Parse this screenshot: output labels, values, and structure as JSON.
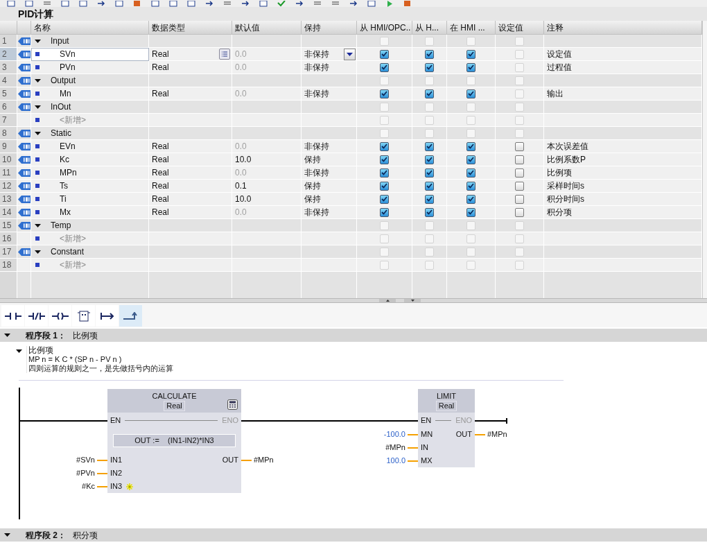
{
  "block_title": "PID计算",
  "columns": [
    "名称",
    "数据类型",
    "默认值",
    "保持",
    "从 HMI/OPC..",
    "从 H...",
    "在 HMI ...",
    "设定值",
    "注释"
  ],
  "rows": [
    {
      "number": "1",
      "kind": "section",
      "name": "Input",
      "expanded": true,
      "selected": false,
      "checks": [
        {
          "checked": false,
          "disabled": true
        },
        {
          "checked": false,
          "disabled": true
        },
        {
          "checked": false,
          "disabled": true
        },
        {
          "checked": false,
          "disabled": true
        }
      ]
    },
    {
      "number": "2",
      "kind": "variable",
      "name": "SVn",
      "type": "Real",
      "default": "0.0",
      "dimmed": true,
      "retain": "非保持",
      "comment": "设定值",
      "selected": true,
      "checks": [
        {
          "checked": true,
          "disabled": false
        },
        {
          "checked": true,
          "disabled": false
        },
        {
          "checked": true,
          "disabled": false
        },
        {
          "checked": false,
          "disabled": true
        }
      ]
    },
    {
      "number": "3",
      "kind": "variable",
      "name": "PVn",
      "type": "Real",
      "default": "0.0",
      "dimmed": true,
      "retain": "非保持",
      "comment": "过程值",
      "selected": false,
      "checks": [
        {
          "checked": true,
          "disabled": false
        },
        {
          "checked": true,
          "disabled": false
        },
        {
          "checked": true,
          "disabled": false
        },
        {
          "checked": false,
          "disabled": true
        }
      ]
    },
    {
      "number": "4",
      "kind": "section",
      "name": "Output",
      "expanded": true,
      "selected": false,
      "checks": [
        {
          "checked": false,
          "disabled": true
        },
        {
          "checked": false,
          "disabled": true
        },
        {
          "checked": false,
          "disabled": true
        },
        {
          "checked": false,
          "disabled": true
        }
      ]
    },
    {
      "number": "5",
      "kind": "variable",
      "name": "Mn",
      "type": "Real",
      "default": "0.0",
      "dimmed": true,
      "retain": "非保持",
      "comment": "输出",
      "selected": false,
      "checks": [
        {
          "checked": true,
          "disabled": false
        },
        {
          "checked": true,
          "disabled": false
        },
        {
          "checked": true,
          "disabled": false
        },
        {
          "checked": false,
          "disabled": true
        }
      ]
    },
    {
      "number": "6",
      "kind": "section",
      "name": "InOut",
      "expanded": true,
      "selected": false,
      "checks": [
        {
          "checked": false,
          "disabled": true
        },
        {
          "checked": false,
          "disabled": true
        },
        {
          "checked": false,
          "disabled": true
        },
        {
          "checked": false,
          "disabled": true
        }
      ]
    },
    {
      "number": "7",
      "kind": "new",
      "name": "<新增>",
      "selected": false,
      "checks": [
        {
          "checked": false,
          "disabled": true
        },
        {
          "checked": false,
          "disabled": true
        },
        {
          "checked": false,
          "disabled": true
        },
        {
          "checked": false,
          "disabled": true
        }
      ]
    },
    {
      "number": "8",
      "kind": "section",
      "name": "Static",
      "expanded": true,
      "selected": false,
      "checks": [
        {
          "checked": false,
          "disabled": true
        },
        {
          "checked": false,
          "disabled": true
        },
        {
          "checked": false,
          "disabled": true
        },
        {
          "checked": false,
          "disabled": true
        }
      ]
    },
    {
      "number": "9",
      "kind": "variable",
      "name": "EVn",
      "type": "Real",
      "default": "0.0",
      "dimmed": true,
      "retain": "非保持",
      "comment": "本次误差值",
      "selected": false,
      "checks": [
        {
          "checked": true,
          "disabled": false
        },
        {
          "checked": true,
          "disabled": false
        },
        {
          "checked": true,
          "disabled": false
        },
        {
          "checked": false,
          "disabled": false
        }
      ]
    },
    {
      "number": "10",
      "kind": "variable",
      "name": "Kc",
      "type": "Real",
      "default": "10.0",
      "dimmed": false,
      "retain": "保持",
      "comment": "比例系数P",
      "selected": false,
      "checks": [
        {
          "checked": true,
          "disabled": false
        },
        {
          "checked": true,
          "disabled": false
        },
        {
          "checked": true,
          "disabled": false
        },
        {
          "checked": false,
          "disabled": false
        }
      ]
    },
    {
      "number": "11",
      "kind": "variable",
      "name": "MPn",
      "type": "Real",
      "default": "0.0",
      "dimmed": true,
      "retain": "非保持",
      "comment": "比例项",
      "selected": false,
      "checks": [
        {
          "checked": true,
          "disabled": false
        },
        {
          "checked": true,
          "disabled": false
        },
        {
          "checked": true,
          "disabled": false
        },
        {
          "checked": false,
          "disabled": false
        }
      ]
    },
    {
      "number": "12",
      "kind": "variable",
      "name": "Ts",
      "type": "Real",
      "default": "0.1",
      "dimmed": false,
      "retain": "保持",
      "comment": "采样时间s",
      "selected": false,
      "checks": [
        {
          "checked": true,
          "disabled": false
        },
        {
          "checked": true,
          "disabled": false
        },
        {
          "checked": true,
          "disabled": false
        },
        {
          "checked": false,
          "disabled": false
        }
      ]
    },
    {
      "number": "13",
      "kind": "variable",
      "name": "Ti",
      "type": "Real",
      "default": "10.0",
      "dimmed": false,
      "retain": "保持",
      "comment": "积分时间s",
      "selected": false,
      "checks": [
        {
          "checked": true,
          "disabled": false
        },
        {
          "checked": true,
          "disabled": false
        },
        {
          "checked": true,
          "disabled": false
        },
        {
          "checked": false,
          "disabled": false
        }
      ]
    },
    {
      "number": "14",
      "kind": "variable",
      "name": "Mx",
      "type": "Real",
      "default": "0.0",
      "dimmed": true,
      "retain": "非保持",
      "comment": "积分项",
      "selected": false,
      "checks": [
        {
          "checked": true,
          "disabled": false
        },
        {
          "checked": true,
          "disabled": false
        },
        {
          "checked": true,
          "disabled": false
        },
        {
          "checked": false,
          "disabled": false
        }
      ]
    },
    {
      "number": "15",
      "kind": "section",
      "name": "Temp",
      "expanded": true,
      "selected": false,
      "checks": [
        {
          "checked": false,
          "disabled": true
        },
        {
          "checked": false,
          "disabled": true
        },
        {
          "checked": false,
          "disabled": true
        },
        {
          "checked": false,
          "disabled": true
        }
      ]
    },
    {
      "number": "16",
      "kind": "new",
      "name": "<新增>",
      "selected": false,
      "checks": [
        {
          "checked": false,
          "disabled": true
        },
        {
          "checked": false,
          "disabled": true
        },
        {
          "checked": false,
          "disabled": true
        },
        {
          "checked": false,
          "disabled": true
        }
      ]
    },
    {
      "number": "17",
      "kind": "section",
      "name": "Constant",
      "expanded": true,
      "selected": false,
      "checks": [
        {
          "checked": false,
          "disabled": true
        },
        {
          "checked": false,
          "disabled": true
        },
        {
          "checked": false,
          "disabled": true
        },
        {
          "checked": false,
          "disabled": true
        }
      ]
    },
    {
      "number": "18",
      "kind": "new",
      "name": "<新增>",
      "selected": false,
      "checks": [
        {
          "checked": false,
          "disabled": true
        },
        {
          "checked": false,
          "disabled": true
        },
        {
          "checked": false,
          "disabled": true
        },
        {
          "checked": false,
          "disabled": true
        }
      ]
    }
  ],
  "ladder_tools": [
    {
      "kind": "contact",
      "selected": false
    },
    {
      "kind": "negated_contact",
      "selected": false
    },
    {
      "kind": "coil",
      "selected": false
    },
    {
      "kind": "empty_box",
      "selected": false
    },
    {
      "kind": "open_branch",
      "selected": false
    },
    {
      "kind": "close_branch",
      "selected": true
    }
  ],
  "networks": [
    {
      "expanded": true,
      "title": "程序段 1：",
      "name": "比例项",
      "comment": {
        "expanded": true,
        "title": "比例项",
        "lines": [
          "MP n = K C * (SP n - PV n )",
          "四则运算的规则之一，是先做括号内的运算"
        ]
      },
      "blocks": [
        {
          "kind": "calculate",
          "title": "CALCULATE",
          "type": "Real",
          "en": "EN",
          "eno": "ENO",
          "formula": "OUT :=    (IN1-IN2)*IN3",
          "inputs": [
            {
              "pin": "IN1",
              "operand": "#SVn",
              "constant": false
            },
            {
              "pin": "IN2",
              "operand": "#PVn",
              "constant": false
            },
            {
              "pin": "IN3",
              "operand": "#Kc",
              "constant": false
            }
          ],
          "outputs": [
            {
              "pin": "OUT",
              "operand": "#MPn",
              "constant": false
            }
          ]
        },
        {
          "kind": "limit",
          "title": "LIMIT",
          "type": "Real",
          "en": "EN",
          "eno": "ENO",
          "inputs": [
            {
              "pin": "MN",
              "operand": "-100.0",
              "constant": true
            },
            {
              "pin": "IN",
              "operand": "#MPn",
              "constant": false
            },
            {
              "pin": "MX",
              "operand": "100.0",
              "constant": true
            }
          ],
          "outputs": [
            {
              "pin": "OUT",
              "operand": "#MPn",
              "constant": false
            }
          ]
        }
      ]
    },
    {
      "expanded": true,
      "title": "程序段 2：",
      "name": "积分项"
    }
  ]
}
